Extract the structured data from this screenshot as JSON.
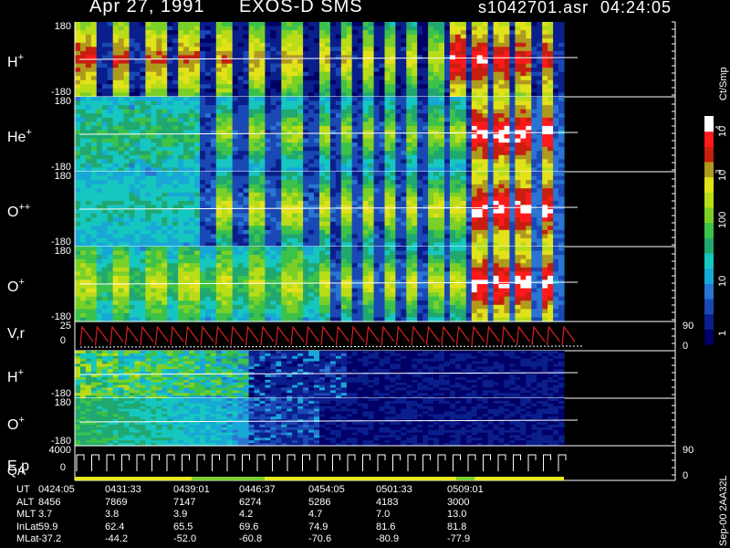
{
  "header": {
    "date": "Apr 27, 1991",
    "instrument": "EXOS-D SMS",
    "filename": "s1042701.asr",
    "time": "04:24:05"
  },
  "chart_data": {
    "type": "heatmap",
    "panels": [
      {
        "label": "H",
        "charge": "+",
        "ytick_top": "180",
        "ytick_bottom": "-180",
        "ylim": [
          -180,
          180
        ]
      },
      {
        "label": "He",
        "charge": "+",
        "ytick_top": "180",
        "ytick_bottom": "-180",
        "ylim": [
          -180,
          180
        ]
      },
      {
        "label": "O",
        "charge": "++",
        "ytick_top": "180",
        "ytick_bottom": "-180",
        "ylim": [
          -180,
          180
        ]
      },
      {
        "label": "O",
        "charge": "+",
        "ytick_top": "180",
        "ytick_bottom": "-180",
        "ylim": [
          -180,
          180
        ]
      },
      {
        "label": "V,r",
        "charge": "",
        "ytick_top": "25",
        "ytick_mid": "0",
        "right_top": "90",
        "right_bottom": "0"
      },
      {
        "label": "H",
        "charge": "+",
        "ytick_top": "",
        "ytick_bottom": "-180"
      },
      {
        "label": "O",
        "charge": "+",
        "ytick_top": "180",
        "ytick_bottom": "-180"
      },
      {
        "label": "E,p",
        "label2": "QA",
        "charge": "",
        "ytick_top": "4000",
        "ytick_mid": "0",
        "right_top": "90",
        "right_bottom": "0"
      }
    ],
    "colorbar": {
      "title": "Ct/Smp",
      "ticks": [
        "10",
        "4",
        "10",
        "3",
        "100",
        "10",
        "1"
      ],
      "scale": "log",
      "range": [
        1,
        10000
      ]
    },
    "orbit_table": {
      "rows": [
        {
          "name": "UT",
          "values": [
            "0424:05",
            "0431:33",
            "0439:01",
            "0446:37",
            "0454:05",
            "0501:33",
            "0509:01"
          ]
        },
        {
          "name": "ALT",
          "values": [
            "8456",
            "7869",
            "7147",
            "6274",
            "5286",
            "4183",
            "3000"
          ]
        },
        {
          "name": "MLT",
          "values": [
            "3.7",
            "3.8",
            "3.9",
            "4.2",
            "4.7",
            "7.0",
            "13.0"
          ]
        },
        {
          "name": "InLat",
          "values": [
            "59.9",
            "62.4",
            "65.5",
            "69.6",
            "74.9",
            "81.6",
            "81.8"
          ]
        },
        {
          "name": "MLat",
          "values": [
            "-37.2",
            "-44.2",
            "-52.0",
            "-60.8",
            "-70.6",
            "-80.9",
            "-77.9"
          ]
        }
      ]
    },
    "side_stamp": "Sep-00  2AA32L"
  }
}
